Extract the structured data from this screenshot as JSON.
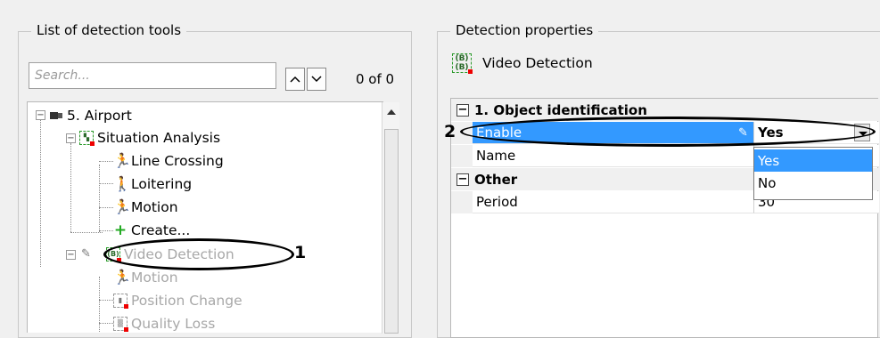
{
  "left_panel": {
    "title": "List of detection tools",
    "search_placeholder": "Search...",
    "match_count": "0 of 0",
    "tree": [
      {
        "label": "5. Airport",
        "icon": "camera-icon"
      },
      {
        "label": "Situation Analysis",
        "icon": "situation-analysis-icon"
      },
      {
        "label": "Line Crossing",
        "icon": "line-crossing-icon"
      },
      {
        "label": "Loitering",
        "icon": "loitering-icon"
      },
      {
        "label": "Motion",
        "icon": "motion-icon"
      },
      {
        "label": "Create...",
        "icon": "plus-icon"
      },
      {
        "label": "Video Detection",
        "icon": "video-detection-icon"
      },
      {
        "label": "Motion",
        "icon": "motion-icon"
      },
      {
        "label": "Position Change",
        "icon": "position-change-icon"
      },
      {
        "label": "Quality Loss",
        "icon": "quality-loss-icon"
      }
    ]
  },
  "right_panel": {
    "title": "Detection properties",
    "header_title": "Video Detection",
    "categories": [
      {
        "label": "1. Object identification",
        "rows": [
          {
            "name": "Enable",
            "value": "Yes"
          },
          {
            "name": "Name",
            "value": ""
          }
        ]
      },
      {
        "label": "Other",
        "rows": [
          {
            "name": "Period",
            "value": "30"
          }
        ]
      }
    ],
    "dropdown_options": [
      "Yes",
      "No"
    ]
  },
  "callouts": {
    "first": "1",
    "second": "2"
  },
  "colors": {
    "selection": "#3399ff",
    "detector_green": "#2a9a2a",
    "marker_red": "#e00000"
  }
}
